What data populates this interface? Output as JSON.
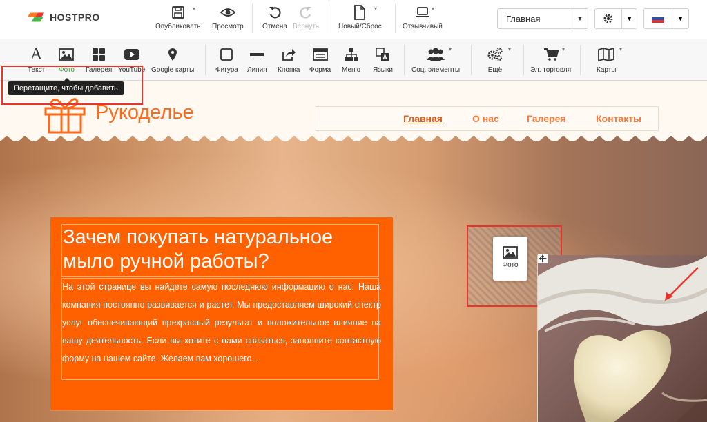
{
  "app": {
    "logo_text": "HOSTPRO"
  },
  "topbar": {
    "publish": "Опубликовать",
    "preview": "Просмотр",
    "undo": "Отмена",
    "redo": "Вернуть",
    "new_reset": "Новый/Сброс",
    "responsive": "Отзывчивый",
    "page_select": "Главная"
  },
  "elements": {
    "text": "Текст",
    "photo": "Фото",
    "gallery": "Галерея",
    "youtube": "YouTube",
    "google_maps": "Google карты",
    "shape": "Фигура",
    "line": "Линия",
    "button": "Кнопка",
    "form": "Форма",
    "menu": "Меню",
    "languages": "Языки",
    "social": "Соц. элементы",
    "more": "Ещё",
    "ecommerce": "Эл. торговля",
    "maps": "Карты"
  },
  "tooltip": "Перетащите, чтобы добавить",
  "site": {
    "title": "Рукоделье",
    "nav": [
      "Главная",
      "О нас",
      "Галерея",
      "Контакты"
    ],
    "heading": "Зачем покупать натуральное мыло ручной работы?",
    "body": "На этой странице вы найдете самую последнюю информацию о нас. Наша компания постоянно развивается и растет. Мы предоставляем широкий спектр услуг обеспечивающий прекрасный результат и положительное влияние на вашу деятельность. Если вы хотите с нами связаться, заполните контактную форму на нашем сайте. Желаем вам хорошего..."
  },
  "drag_card_label": "Фото",
  "colors": {
    "accent": "#ff6000",
    "active_tool": "#35a532",
    "highlight": "#e8342a"
  }
}
